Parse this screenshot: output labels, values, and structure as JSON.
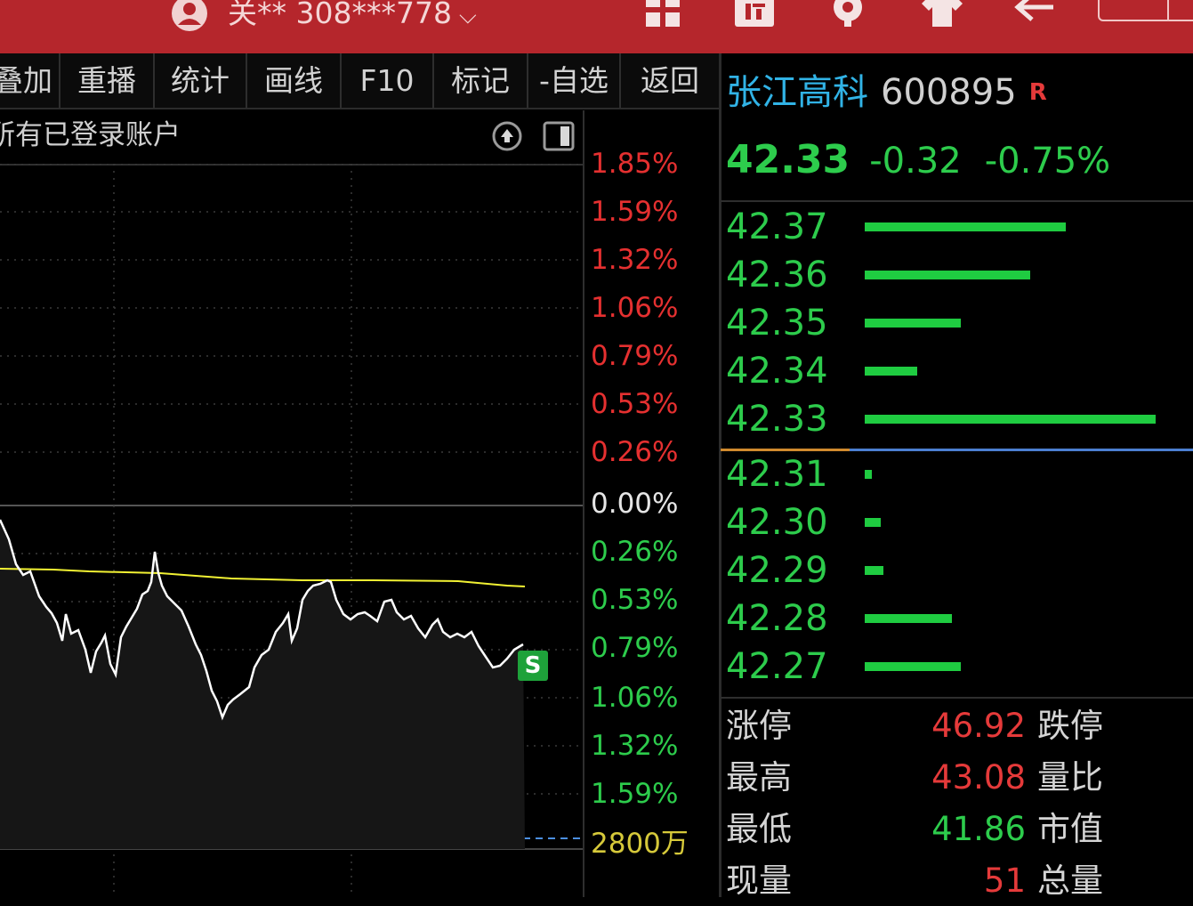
{
  "topbar": {
    "account": "关** 308***778",
    "chevron": "⌵",
    "icons": [
      "user-icon",
      "grid-icon",
      "calendar-icon",
      "gear-icon",
      "shirt-icon",
      "back-arrow-icon",
      "window-button-icon"
    ]
  },
  "toolbar": {
    "items": [
      "叠加",
      "重播",
      "统计",
      "画线",
      "F10",
      "标记",
      "-自选",
      "返回"
    ]
  },
  "chart": {
    "account_title": "所有已登录账户",
    "upper_labels": [
      "1.85%",
      "1.59%",
      "1.32%",
      "1.06%",
      "0.79%",
      "0.53%",
      "0.26%"
    ],
    "zero_label": "0.00%",
    "lower_labels": [
      "0.26%",
      "0.53%",
      "0.79%",
      "1.06%",
      "1.32%",
      "1.59%"
    ],
    "volume_label": "2800万",
    "signal_badge": "S",
    "colors": {
      "up": "#e53030",
      "down": "#2dcc4c",
      "zero": "#e6e6e6",
      "volume": "#d6c93a",
      "price_line": "#ffffff",
      "avg_line": "#f2f233"
    }
  },
  "stock": {
    "name": "张江高科",
    "code": "600895",
    "flag": "R",
    "price": "42.33",
    "change": "-0.32",
    "change_pct": "-0.75%"
  },
  "orderbook": {
    "asks": [
      {
        "price": "42.37",
        "size": 0.69
      },
      {
        "price": "42.36",
        "size": 0.57
      },
      {
        "price": "42.35",
        "size": 0.33
      },
      {
        "price": "42.34",
        "size": 0.18
      },
      {
        "price": "42.33",
        "size": 1.0
      }
    ],
    "bids": [
      {
        "price": "42.31",
        "size": 0.025
      },
      {
        "price": "42.30",
        "size": 0.055
      },
      {
        "price": "42.29",
        "size": 0.065
      },
      {
        "price": "42.28",
        "size": 0.3
      },
      {
        "price": "42.27",
        "size": 0.33
      }
    ]
  },
  "stats": [
    {
      "label": "涨停",
      "value": "46.92",
      "label2": "跌停",
      "color": "#e53a3a"
    },
    {
      "label": "最高",
      "value": "43.08",
      "label2": "量比",
      "color": "#e53a3a"
    },
    {
      "label": "最低",
      "value": "41.86",
      "label2": "市值",
      "color": "#2dcc4c"
    },
    {
      "label": "现量",
      "value": "51",
      "label2": "总量",
      "color": "#e53a3a"
    }
  ]
}
